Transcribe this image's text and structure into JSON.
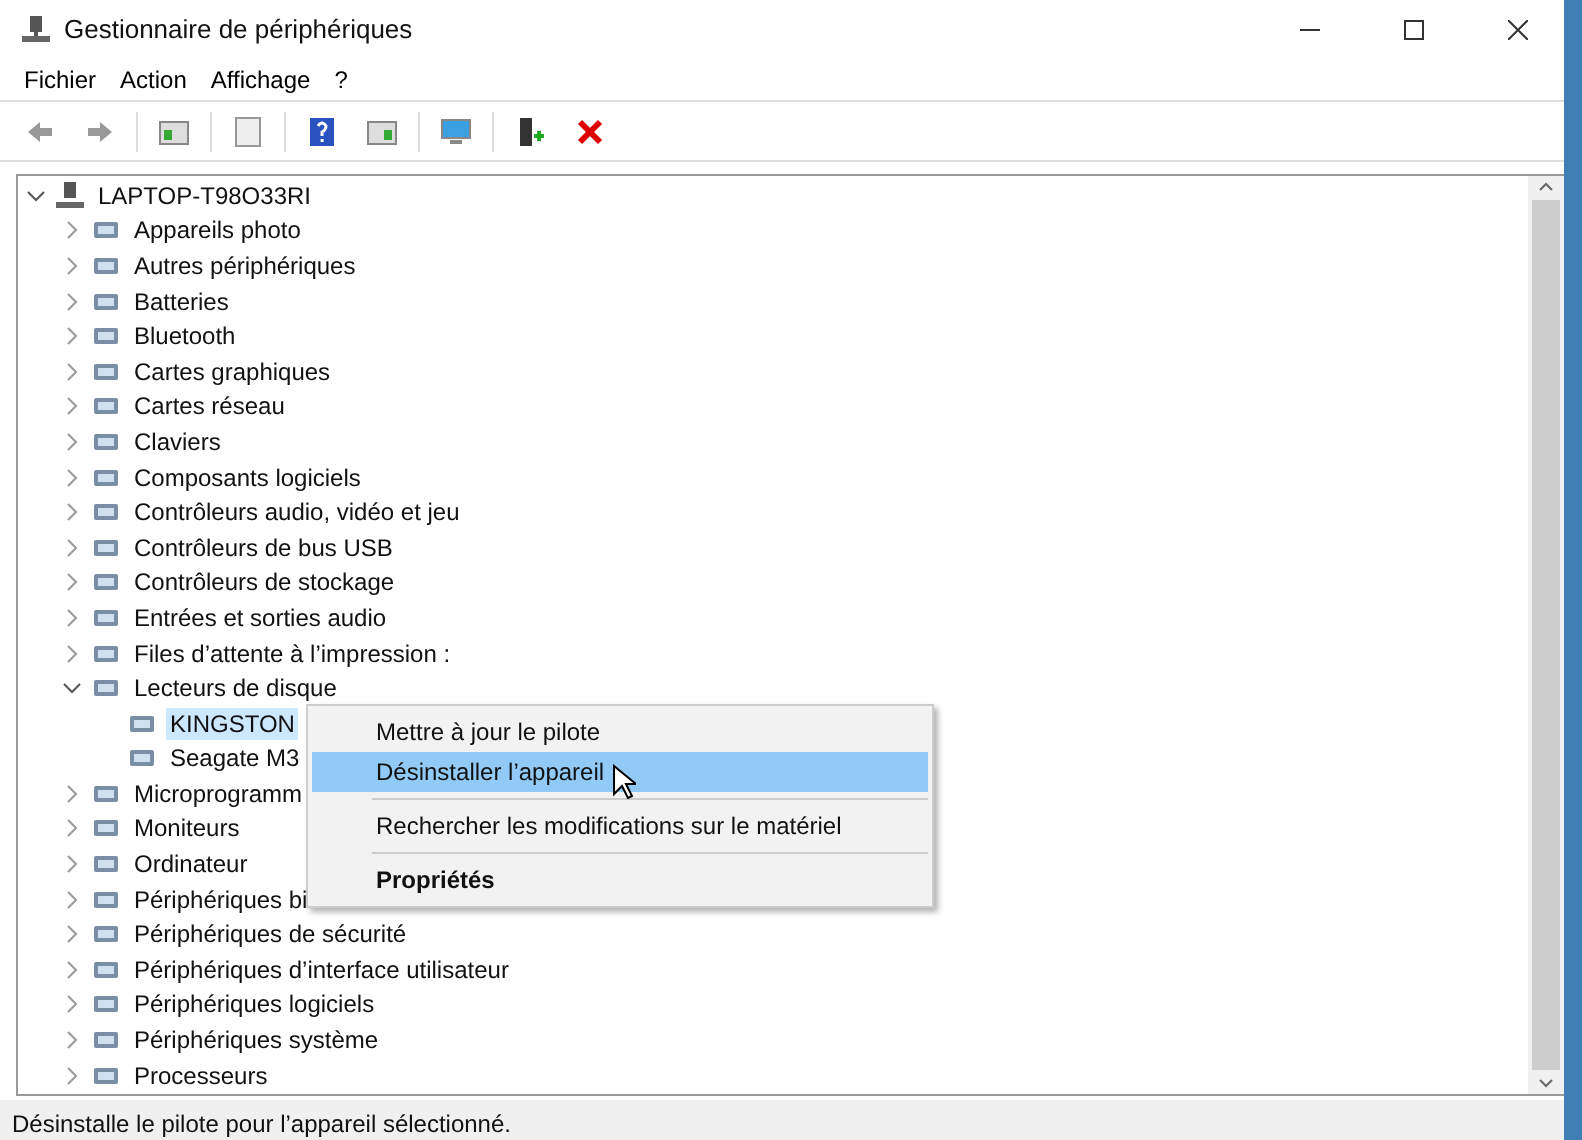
{
  "window": {
    "title": "Gestionnaire de périphériques"
  },
  "menu": [
    "Fichier",
    "Action",
    "Affichage",
    "?"
  ],
  "tree": {
    "label": "LAPTOP-T98O33RI",
    "expanded": true,
    "children": [
      {
        "label": "Appareils photo",
        "expanded": false
      },
      {
        "label": "Autres périphériques",
        "expanded": false
      },
      {
        "label": "Batteries",
        "expanded": false
      },
      {
        "label": "Bluetooth",
        "expanded": false
      },
      {
        "label": "Cartes graphiques",
        "expanded": false
      },
      {
        "label": "Cartes réseau",
        "expanded": false
      },
      {
        "label": "Claviers",
        "expanded": false
      },
      {
        "label": "Composants logiciels",
        "expanded": false
      },
      {
        "label": "Contrôleurs audio, vidéo et jeu",
        "expanded": false
      },
      {
        "label": "Contrôleurs de bus USB",
        "expanded": false
      },
      {
        "label": "Contrôleurs de stockage",
        "expanded": false
      },
      {
        "label": "Entrées et sorties audio",
        "expanded": false
      },
      {
        "label": "Files d’attente à l’impression :",
        "expanded": false
      },
      {
        "label": "Lecteurs de disque",
        "expanded": true,
        "children": [
          {
            "label": "KINGSTON",
            "selected": true
          },
          {
            "label": "Seagate M3",
            "selected": false
          }
        ]
      },
      {
        "label": "Microprogramm",
        "expanded": false
      },
      {
        "label": "Moniteurs",
        "expanded": false
      },
      {
        "label": "Ordinateur",
        "expanded": false
      },
      {
        "label": "Périphériques bi",
        "expanded": false
      },
      {
        "label": "Périphériques de sécurité",
        "expanded": false
      },
      {
        "label": "Périphériques d’interface utilisateur",
        "expanded": false
      },
      {
        "label": "Périphériques logiciels",
        "expanded": false
      },
      {
        "label": "Périphériques système",
        "expanded": false
      },
      {
        "label": "Processeurs",
        "expanded": false
      }
    ]
  },
  "context_menu": [
    {
      "kind": "item",
      "label": "Mettre à jour le pilote",
      "selected": false,
      "bold": false
    },
    {
      "kind": "item",
      "label": "Désinstaller l’appareil",
      "selected": true,
      "bold": false
    },
    {
      "kind": "separator"
    },
    {
      "kind": "item",
      "label": "Rechercher les modifications sur le matériel",
      "selected": false,
      "bold": false
    },
    {
      "kind": "separator"
    },
    {
      "kind": "item",
      "label": "Propriétés",
      "selected": false,
      "bold": true
    }
  ],
  "status_bar": "Désinstalle le pilote pour l’appareil sélectionné."
}
